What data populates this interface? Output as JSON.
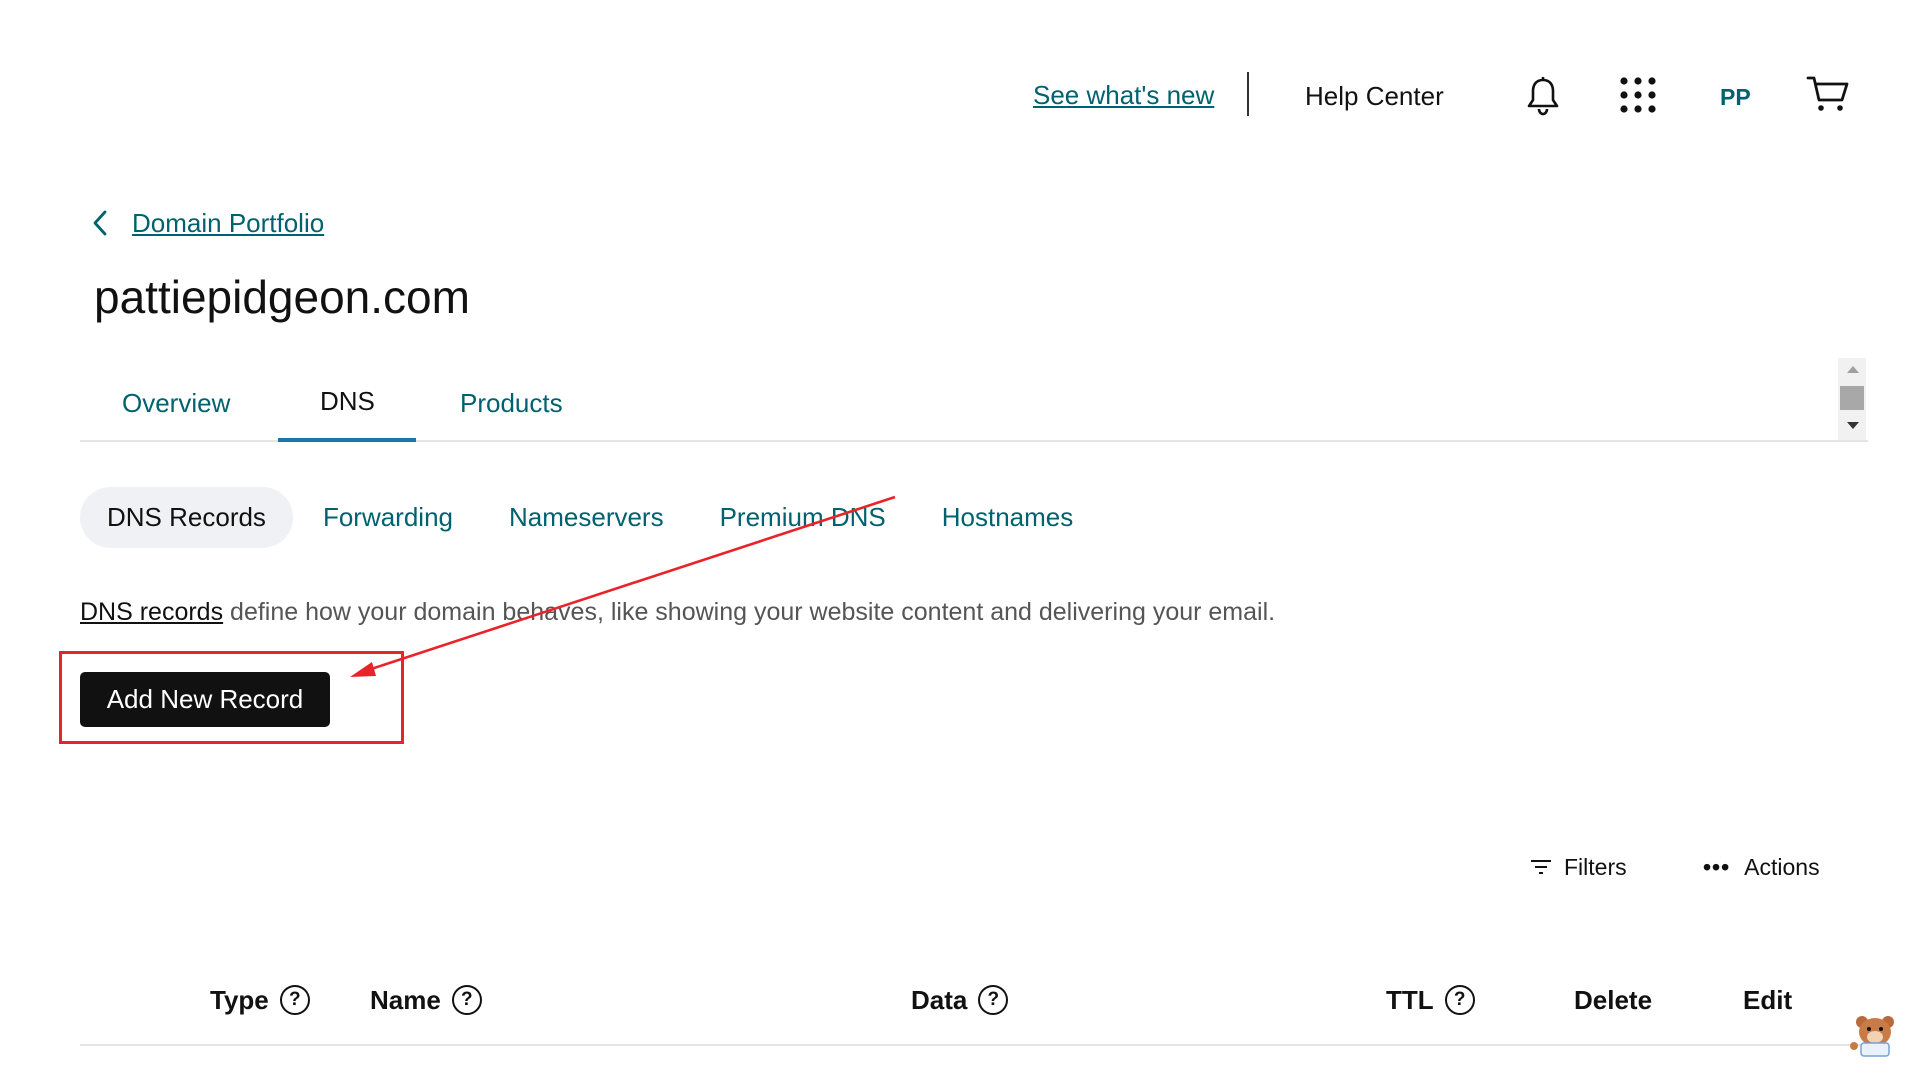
{
  "header": {
    "whats_new": "See what's new",
    "help_center": "Help Center",
    "avatar_initials": "PP"
  },
  "breadcrumb": {
    "label": "Domain Portfolio"
  },
  "page_title": "pattiepidgeon.com",
  "main_tabs": [
    {
      "label": "Overview",
      "active": false
    },
    {
      "label": "DNS",
      "active": true
    },
    {
      "label": "Products",
      "active": false
    }
  ],
  "sub_tabs": [
    {
      "label": "DNS Records",
      "active": true
    },
    {
      "label": "Forwarding",
      "active": false
    },
    {
      "label": "Nameservers",
      "active": false
    },
    {
      "label": "Premium DNS",
      "active": false
    },
    {
      "label": "Hostnames",
      "active": false
    }
  ],
  "description": {
    "link": "DNS records",
    "text": " define how your domain behaves, like showing your website content and delivering your email."
  },
  "add_button": "Add New Record",
  "toolbar": {
    "filters": "Filters",
    "actions": "Actions"
  },
  "table": {
    "columns": [
      {
        "label": "Type",
        "help": true
      },
      {
        "label": "Name",
        "help": true
      },
      {
        "label": "Data",
        "help": true
      },
      {
        "label": "TTL",
        "help": true
      },
      {
        "label": "Delete",
        "help": false
      },
      {
        "label": "Edit",
        "help": false
      }
    ],
    "help_glyph": "?"
  },
  "icons": {
    "bell": "bell-icon",
    "apps": "apps-grid-icon",
    "cart": "cart-icon",
    "back": "chevron-left-icon",
    "filters": "filter-icon",
    "actions": "more-horizontal-icon",
    "help": "help-circle-icon"
  },
  "colors": {
    "link": "#00626e",
    "active_underline": "#1976a8",
    "annotation": "#e8242a",
    "button_bg": "#111111"
  }
}
